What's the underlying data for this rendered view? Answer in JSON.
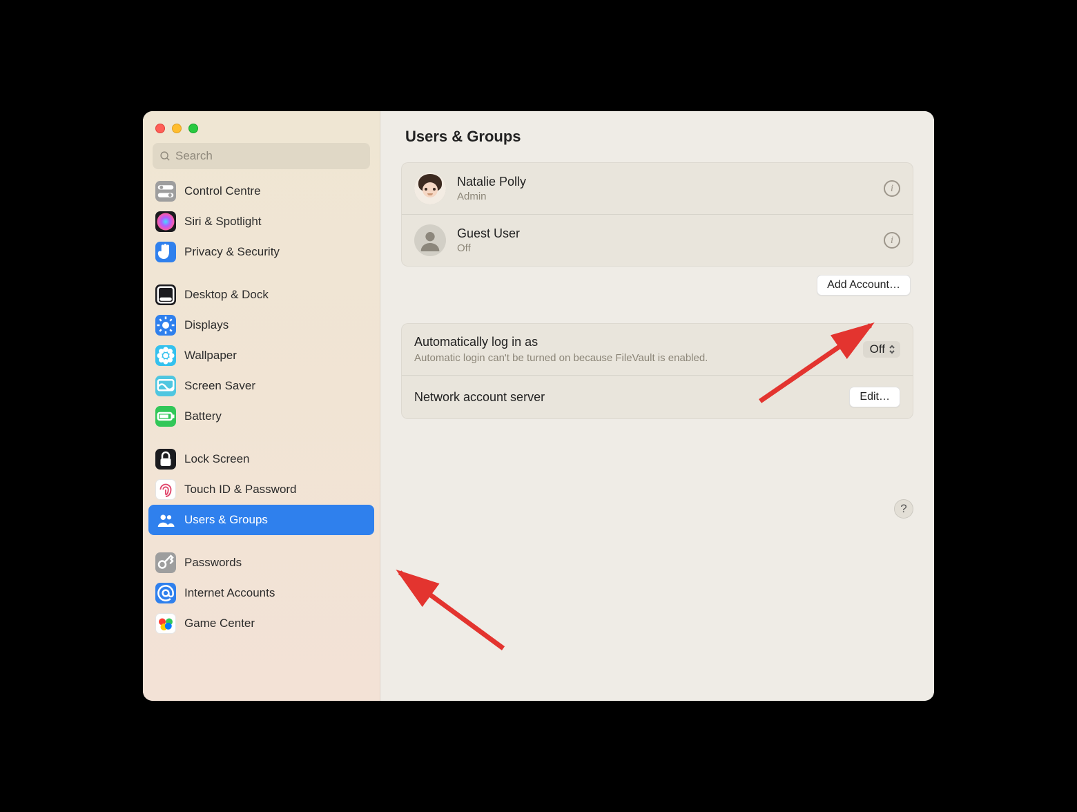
{
  "search": {
    "placeholder": "Search"
  },
  "sidebar": {
    "items": [
      {
        "label": "Control Centre",
        "icon_bg": "#9e9e9e",
        "svg": "switches"
      },
      {
        "label": "Siri & Spotlight",
        "icon_bg": "#1b1b1f",
        "svg": "siri"
      },
      {
        "label": "Privacy & Security",
        "icon_bg": "#2f80ed",
        "svg": "hand"
      },
      {
        "spacer": true
      },
      {
        "label": "Desktop & Dock",
        "icon_bg": "#1b1b1f",
        "svg": "dock"
      },
      {
        "label": "Displays",
        "icon_bg": "#2f80ed",
        "svg": "sun"
      },
      {
        "label": "Wallpaper",
        "icon_bg": "#34c1ee",
        "svg": "flower"
      },
      {
        "label": "Screen Saver",
        "icon_bg": "#4fc6e0",
        "svg": "screen"
      },
      {
        "label": "Battery",
        "icon_bg": "#32c758",
        "svg": "battery"
      },
      {
        "spacer": true
      },
      {
        "label": "Lock Screen",
        "icon_bg": "#1b1b1f",
        "svg": "lock"
      },
      {
        "label": "Touch ID & Password",
        "icon_bg": "#ffffff",
        "svg": "finger"
      },
      {
        "label": "Users & Groups",
        "icon_bg": "#2f80ed",
        "svg": "people",
        "selected": true
      },
      {
        "spacer": true
      },
      {
        "label": "Passwords",
        "icon_bg": "#9e9e9e",
        "svg": "key"
      },
      {
        "label": "Internet Accounts",
        "icon_bg": "#2f80ed",
        "svg": "at"
      },
      {
        "label": "Game Center",
        "icon_bg": "#ffffff",
        "svg": "gc"
      }
    ]
  },
  "page": {
    "title": "Users & Groups"
  },
  "users": [
    {
      "name": "Natalie Polly",
      "role": "Admin",
      "avatar": "memoji"
    },
    {
      "name": "Guest User",
      "role": "Off",
      "avatar": "guest"
    }
  ],
  "buttons": {
    "add_account": "Add Account…",
    "edit_server": "Edit…",
    "help": "?"
  },
  "settings": {
    "autologin_title": "Automatically log in as",
    "autologin_sub": "Automatic login can't be turned on because FileVault is enabled.",
    "autologin_value": "Off",
    "network_title": "Network account server"
  }
}
